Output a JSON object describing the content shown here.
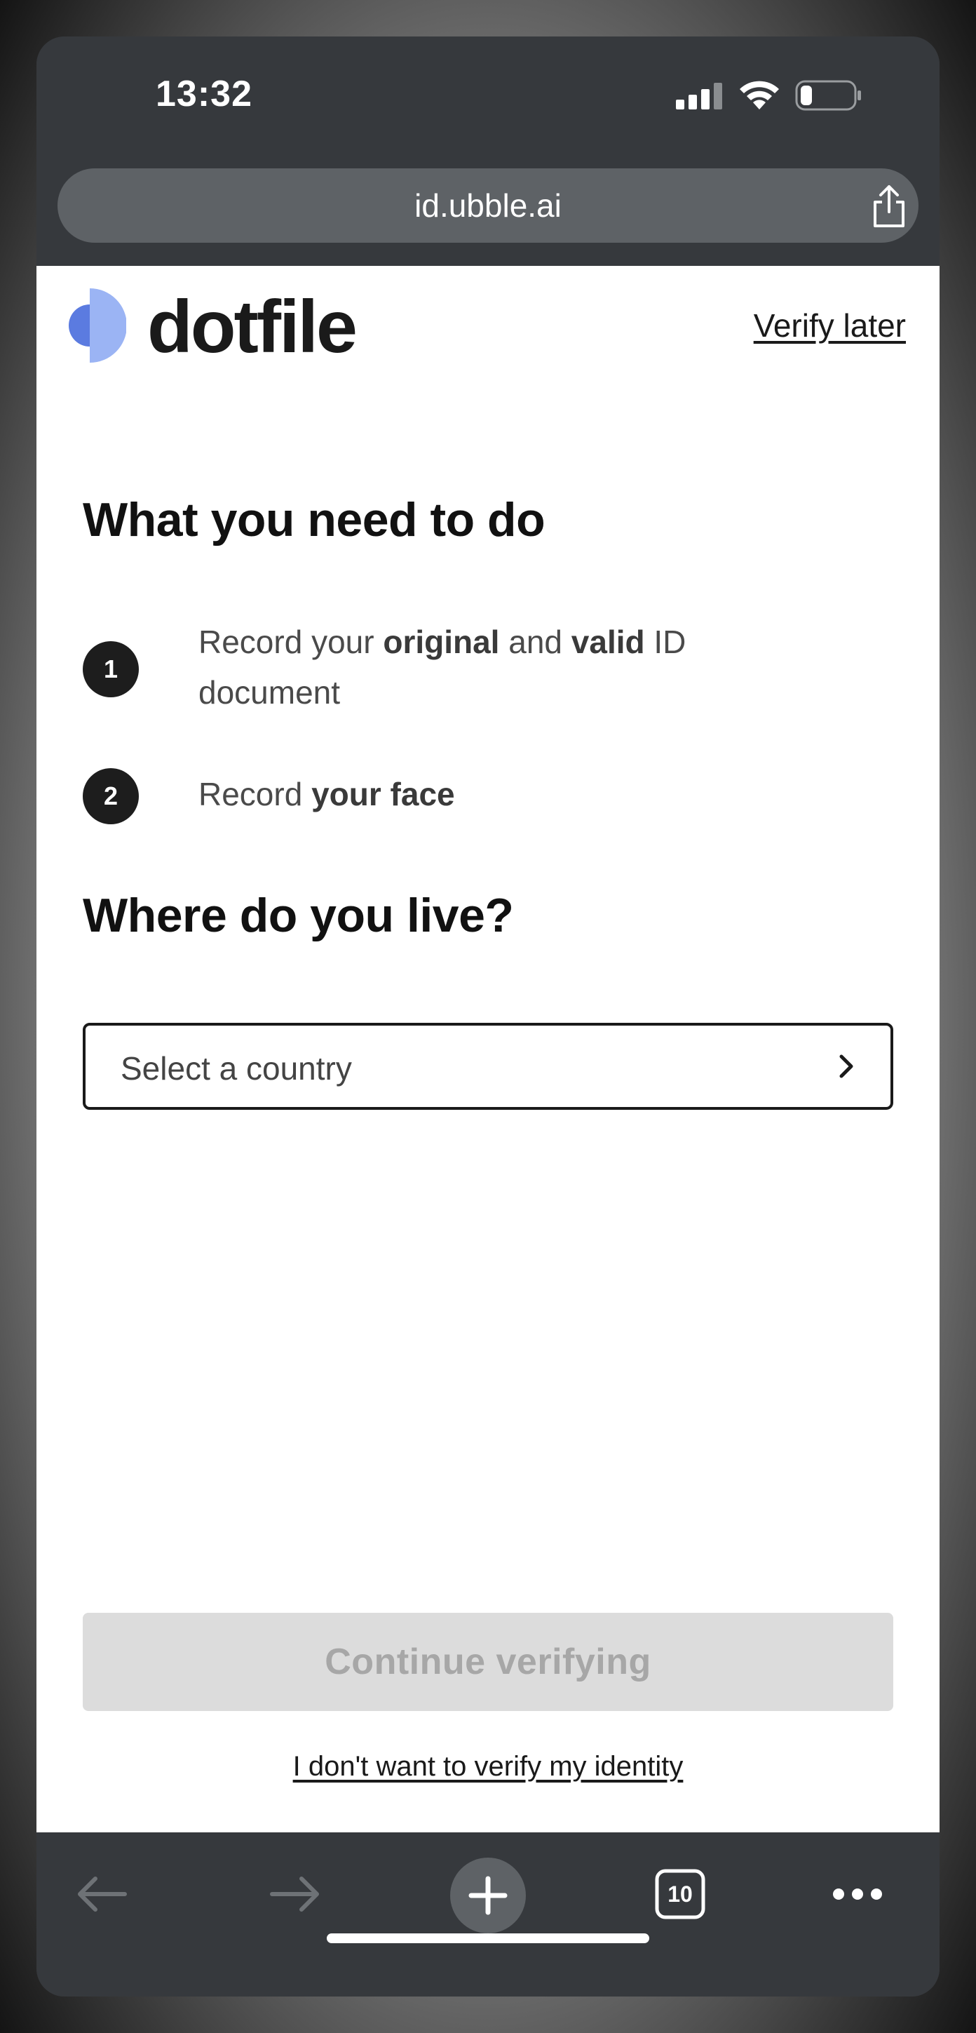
{
  "status_bar": {
    "time": "13:32"
  },
  "browser": {
    "url": "id.ubble.ai",
    "tab_count": "10"
  },
  "header": {
    "logo_text": "dotfile",
    "verify_later": "Verify later"
  },
  "instructions": {
    "heading": "What you need to do",
    "steps": [
      {
        "number": "1",
        "parts": [
          "Record your ",
          "original",
          " and ",
          "valid",
          " ID document"
        ]
      },
      {
        "number": "2",
        "parts": [
          "Record ",
          "your face"
        ]
      }
    ]
  },
  "residence": {
    "heading": "Where do you live?",
    "select_placeholder": "Select a country"
  },
  "actions": {
    "continue_label": "Continue verifying",
    "decline_label": "I don't want to verify my identity"
  },
  "colors": {
    "brand_light": "#9bb4f4",
    "brand_dark": "#5b7be0"
  }
}
